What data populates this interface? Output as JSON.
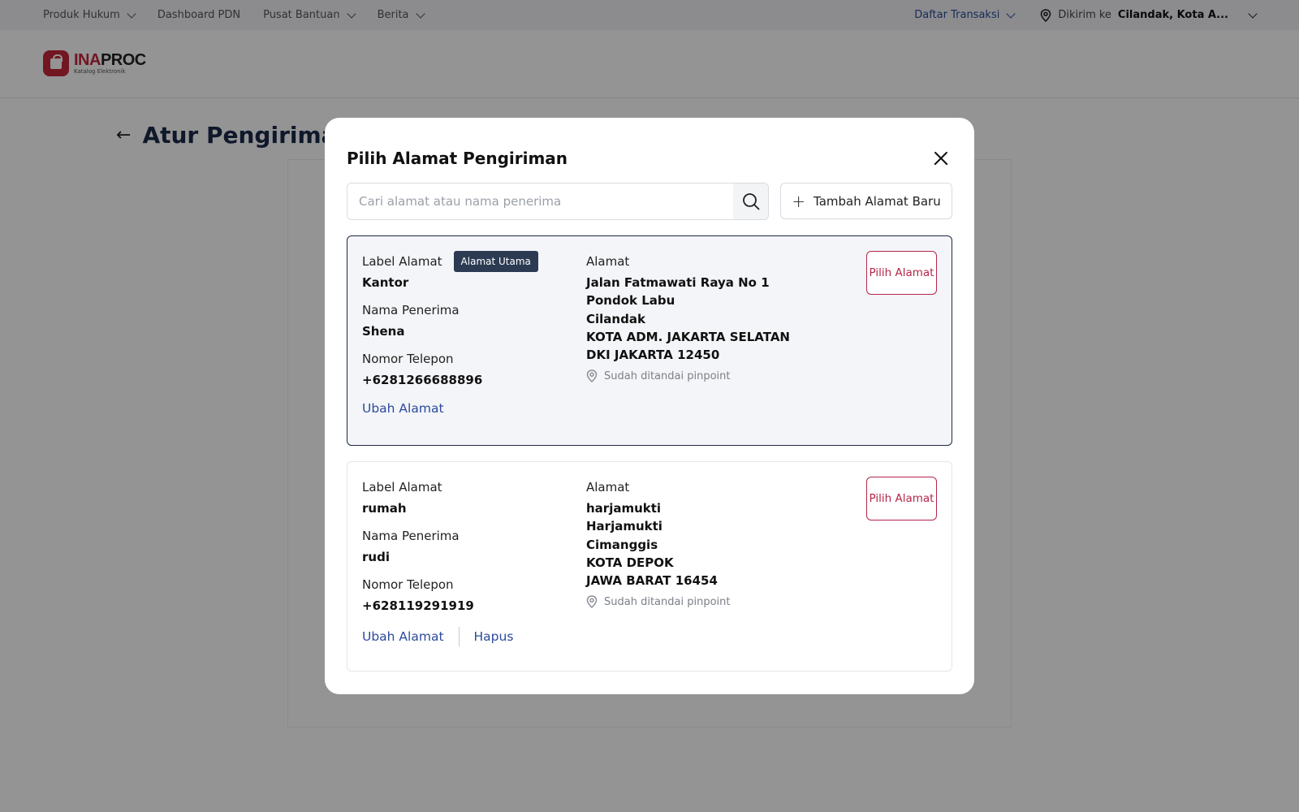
{
  "topbar": {
    "nav": [
      "Produk Hukum",
      "Dashboard PDN",
      "Pusat Bantuan",
      "Berita"
    ],
    "transactions": "Daftar Transaksi",
    "ship_to_label": "Dikirim ke",
    "ship_to_value": "Cilandak, Kota A..."
  },
  "logo": {
    "main_a": "INA",
    "main_b": "PROC",
    "sub": "Katalog Elektronik"
  },
  "page": {
    "title": "Atur Pengiriman"
  },
  "modal": {
    "title": "Pilih Alamat Pengiriman",
    "search_placeholder": "Cari alamat atau nama penerima",
    "add_button": "Tambah Alamat Baru",
    "labels": {
      "label_alamat": "Label Alamat",
      "nama_penerima": "Nama Penerima",
      "nomor_telepon": "Nomor Telepon",
      "alamat": "Alamat",
      "pick": "Pilih Alamat"
    },
    "addresses": [
      {
        "badge": "Alamat Utama",
        "label": "Kantor",
        "recipient": "Shena",
        "phone": "+6281266688896",
        "lines": [
          "Jalan Fatmawati Raya No 1",
          "Pondok Labu",
          "Cilandak",
          "KOTA ADM. JAKARTA SELATAN",
          "DKI JAKARTA 12450"
        ],
        "pinpoint": "Sudah ditandai pinpoint",
        "edit": "Ubah Alamat"
      },
      {
        "label": "rumah",
        "recipient": "rudi",
        "phone": "+628119291919",
        "lines": [
          "harjamukti",
          "Harjamukti",
          "Cimanggis",
          "KOTA DEPOK",
          "JAWA BARAT 16454"
        ],
        "pinpoint": "Sudah ditandai pinpoint",
        "edit": "Ubah Alamat",
        "delete": "Hapus"
      }
    ]
  },
  "colors": {
    "brand": "#c4263b",
    "link": "#2b4a9c",
    "pick": "#b4264a",
    "badge": "#2c3a52"
  }
}
